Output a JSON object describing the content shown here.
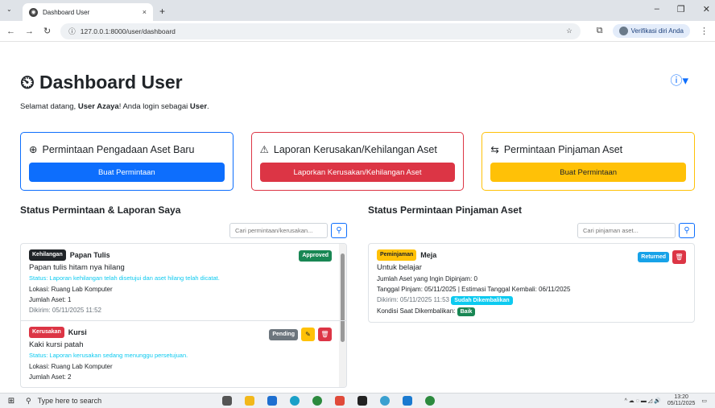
{
  "browser": {
    "tab_title": "Dashboard User",
    "tab_close": "×",
    "new_tab": "+",
    "url": "127.0.0.1:8000/user/dashboard",
    "profile_label": "Verifikasi diri Anda"
  },
  "header": {
    "title": "Dashboard User",
    "welcome_prefix": "Selamat datang, ",
    "user_name": "User Azaya",
    "welcome_mid": "! Anda login sebagai ",
    "role": "User",
    "welcome_end": "."
  },
  "cards": [
    {
      "title": "Permintaan Pengadaan Aset Baru",
      "button": "Buat Permintaan",
      "icon": "plus-circle-icon"
    },
    {
      "title": "Laporan Kerusakan/Kehilangan Aset",
      "button": "Laporkan Kerusakan/Kehilangan Aset",
      "icon": "warning-icon"
    },
    {
      "title": "Permintaan Pinjaman Aset",
      "button": "Buat Permintaan",
      "icon": "exchange-icon"
    }
  ],
  "left": {
    "title": "Status Permintaan & Laporan Saya",
    "search_placeholder": "Cari permintaan/kerusakan...",
    "items": [
      {
        "type": "Kehilangan",
        "name": "Papan Tulis",
        "status": "Approved",
        "desc": "Papan tulis hitam nya hilang",
        "status_text": "Status: Laporan kehilangan telah disetujui dan aset hilang telah dicatat.",
        "lokasi": "Lokasi: Ruang Lab Komputer",
        "jumlah": "Jumlah Aset: 1",
        "dikirim": "Dikirim: 05/11/2025 11:52"
      },
      {
        "type": "Kerusakan",
        "name": "Kursi",
        "status": "Pending",
        "desc": "Kaki kursi patah",
        "status_text": "Status: Laporan kerusakan sedang menunggu persetujuan.",
        "lokasi": "Lokasi: Ruang Lab Komputer",
        "jumlah": "Jumlah Aset: 2"
      }
    ]
  },
  "right": {
    "title": "Status Permintaan Pinjaman Aset",
    "search_placeholder": "Cari pinjaman aset...",
    "item": {
      "type": "Peminjaman",
      "name": "Meja",
      "status": "Returned",
      "desc": "Untuk belajar",
      "jumlah": "Jumlah Aset yang Ingin Dipinjam: 0",
      "tanggal": "Tanggal Pinjam: 05/11/2025 | Estimasi Tanggal Kembali: 06/11/2025",
      "dikirim": "Dikirim: 05/11/2025 11:53",
      "returned_badge": "Sudah Dikembalikan",
      "kondisi_label": "Kondisi Saat Dikembalikan:",
      "kondisi": "Baik"
    }
  },
  "taskbar": {
    "search_placeholder": "Type here to search",
    "time": "13:20",
    "date": "05/11/2025"
  }
}
